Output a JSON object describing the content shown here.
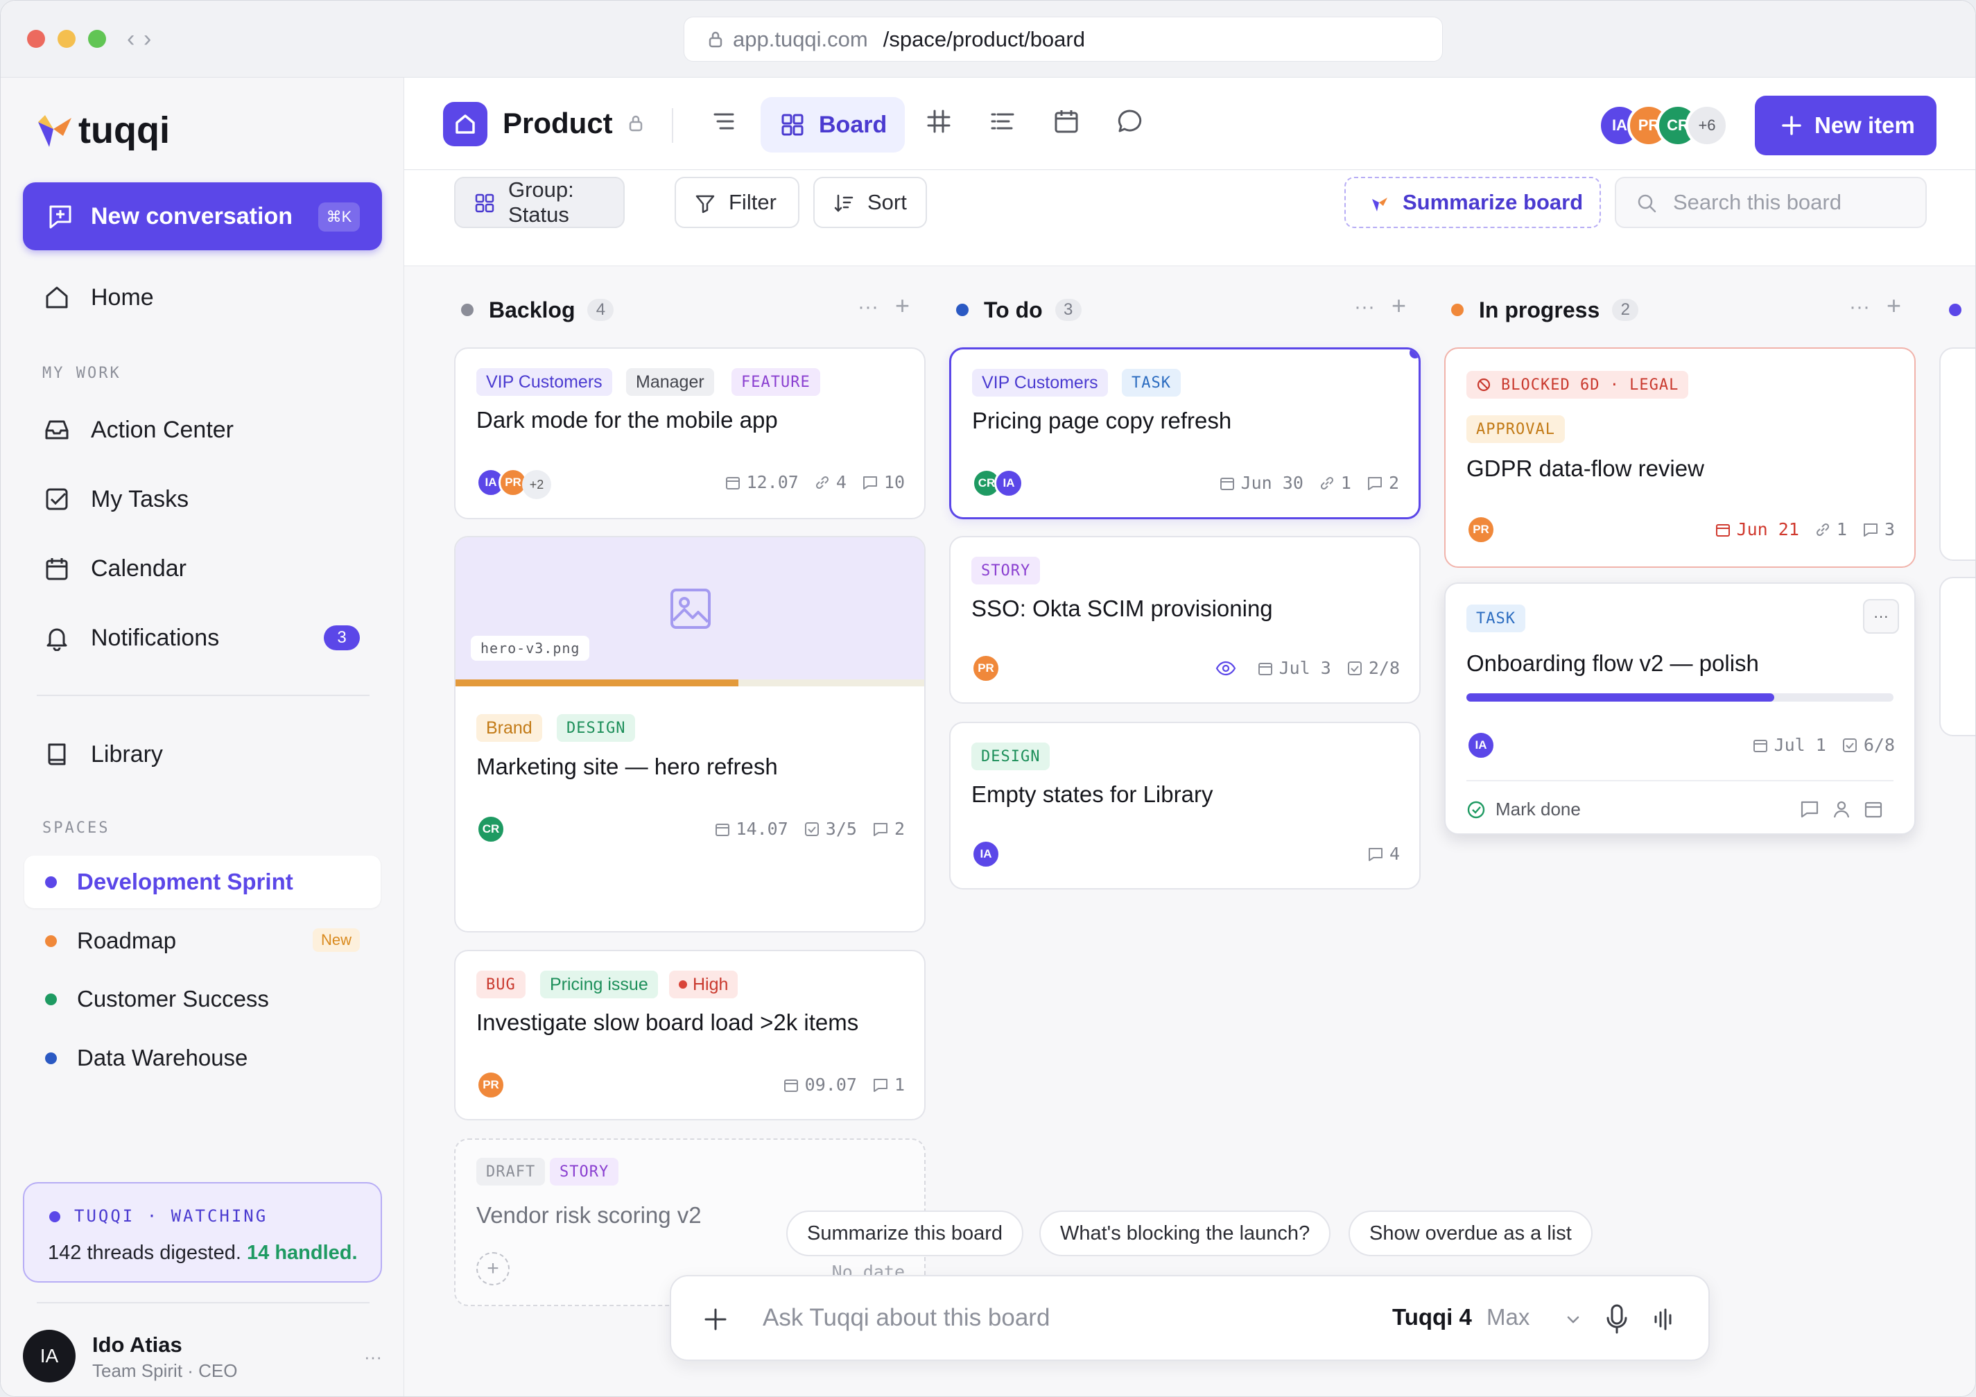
{
  "browser": {
    "host": "app.tuqqi.com",
    "path": "/space/product/board"
  },
  "sidebar": {
    "brand": "tuqqi",
    "new_conversation": {
      "label": "New conversation",
      "shortcut": "⌘K"
    },
    "home": "Home",
    "my_work_title": "MY WORK",
    "my_work": [
      {
        "label": "Action Center",
        "icon": "inbox-icon"
      },
      {
        "label": "My Tasks",
        "icon": "checkbox-icon"
      },
      {
        "label": "Calendar",
        "icon": "calendar-icon"
      },
      {
        "label": "Notifications",
        "icon": "bell-icon",
        "badge": "3"
      }
    ],
    "library": "Library",
    "spaces_title": "SPACES",
    "spaces": [
      {
        "label": "Development Sprint",
        "color": "#5b47e8",
        "active": true
      },
      {
        "label": "Roadmap",
        "color": "#f0883a",
        "tag": "New"
      },
      {
        "label": "Customer Success",
        "color": "#1e9a62"
      },
      {
        "label": "Data Warehouse",
        "color": "#2b59c3"
      }
    ],
    "watching": {
      "title": "TUQQI · WATCHING",
      "text": "142 threads digested.",
      "handled": "14 handled."
    },
    "user": {
      "initials": "IA",
      "name": "Ido Atias",
      "role": "Team Spirit · CEO"
    }
  },
  "header": {
    "title": "Product",
    "active_view": "Board",
    "members": [
      {
        "initials": "IA",
        "color": "#5b47e8"
      },
      {
        "initials": "PR",
        "color": "#f0883a"
      },
      {
        "initials": "CR",
        "color": "#1e9a62"
      }
    ],
    "members_more": "+6",
    "new_item": "New item"
  },
  "toolbar": {
    "group": "Group: Status",
    "filter": "Filter",
    "sort": "Sort",
    "summarize": "Summarize board",
    "search_placeholder": "Search this board"
  },
  "columns": [
    {
      "name": "Backlog",
      "count": "4",
      "color": "#8b8d98"
    },
    {
      "name": "To do",
      "count": "3",
      "color": "#2b59c3"
    },
    {
      "name": "In progress",
      "count": "2",
      "color": "#f0883a"
    }
  ],
  "cards": {
    "dark_mode": {
      "tags": [
        "VIP Customers",
        "Manager",
        "FEATURE"
      ],
      "title": "Dark mode for the mobile app",
      "avatars": [
        "IA",
        "PR"
      ],
      "more": "+2",
      "date": "12.07",
      "links": "4",
      "comments": "10"
    },
    "hero": {
      "file": "hero-v3.png",
      "progress": 0.6,
      "tags": [
        "Brand",
        "DESIGN"
      ],
      "title": "Marketing site — hero refresh",
      "avatar": "CR",
      "date": "14.07",
      "checks": "3/5",
      "comments": "2"
    },
    "slow_load": {
      "tags": [
        "BUG",
        "Pricing issue",
        "High"
      ],
      "title": "Investigate slow board load >2k items",
      "avatar": "PR",
      "date": "09.07",
      "comments": "1"
    },
    "vendor": {
      "tags": [
        "DRAFT",
        "STORY"
      ],
      "title": "Vendor risk scoring v2",
      "date": "No date"
    },
    "pricing": {
      "tags": [
        "VIP Customers",
        "TASK"
      ],
      "title": "Pricing page copy refresh",
      "avatars": [
        "CR",
        "IA"
      ],
      "date": "Jun 30",
      "links": "1",
      "comments": "2"
    },
    "sso": {
      "tags": [
        "STORY"
      ],
      "title": "SSO: Okta SCIM provisioning",
      "avatar": "PR",
      "date": "Jul 3",
      "checks": "2/8"
    },
    "empty": {
      "tags": [
        "DESIGN"
      ],
      "title": "Empty states for Library",
      "avatar": "IA",
      "comments": "4"
    },
    "gdpr": {
      "blocked": "BLOCKED 6D · LEGAL",
      "tags": [
        "APPROVAL"
      ],
      "title": "GDPR data-flow review",
      "avatar": "PR",
      "date": "Jun 21",
      "links": "1",
      "comments": "3"
    },
    "onboarding": {
      "tags": [
        "TASK"
      ],
      "title": "Onboarding flow v2 — polish",
      "progress": 0.72,
      "avatar": "IA",
      "date": "Jul 1",
      "checks": "6/8",
      "mark_done": "Mark done"
    }
  },
  "suggestions": [
    "Summarize this board",
    "What's blocking the launch?",
    "Show overdue as a list"
  ],
  "ask": {
    "placeholder": "Ask Tuqqi about this board",
    "model": "Tuqqi 4",
    "tier": "Max"
  }
}
